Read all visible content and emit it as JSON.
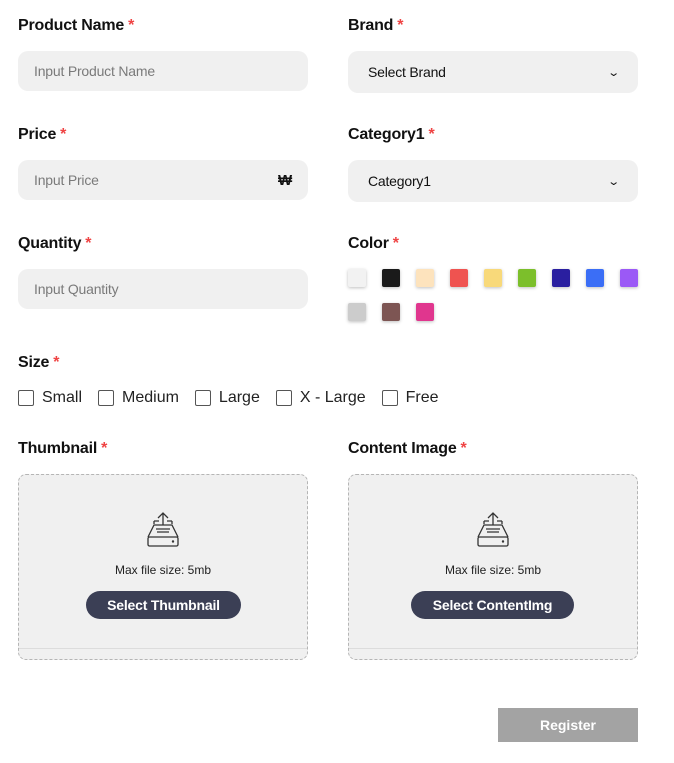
{
  "required_mark": "*",
  "fields": {
    "product_name": {
      "label": "Product Name",
      "placeholder": "Input Product Name"
    },
    "brand": {
      "label": "Brand",
      "selected": "Select Brand"
    },
    "price": {
      "label": "Price",
      "placeholder": "Input Price",
      "currency": "₩"
    },
    "category1": {
      "label": "Category1",
      "selected": "Category1"
    },
    "quantity": {
      "label": "Quantity",
      "placeholder": "Input Quantity"
    },
    "color": {
      "label": "Color",
      "swatches": [
        "#f2f2f2",
        "#1a1a1a",
        "#fde3bd",
        "#ef5350",
        "#f8d97a",
        "#7cbf2b",
        "#2a1fa0",
        "#3b6ef6",
        "#9b59f6",
        "#cccccc",
        "#7d5553",
        "#e0368e"
      ]
    },
    "size": {
      "label": "Size",
      "options": [
        "Small",
        "Medium",
        "Large",
        "X - Large",
        "Free"
      ]
    },
    "thumbnail": {
      "label": "Thumbnail",
      "note": "Max file size: 5mb",
      "button": "Select Thumbnail"
    },
    "content_image": {
      "label": "Content Image",
      "note": "Max file size: 5mb",
      "button": "Select ContentImg"
    }
  },
  "register_label": "Register"
}
